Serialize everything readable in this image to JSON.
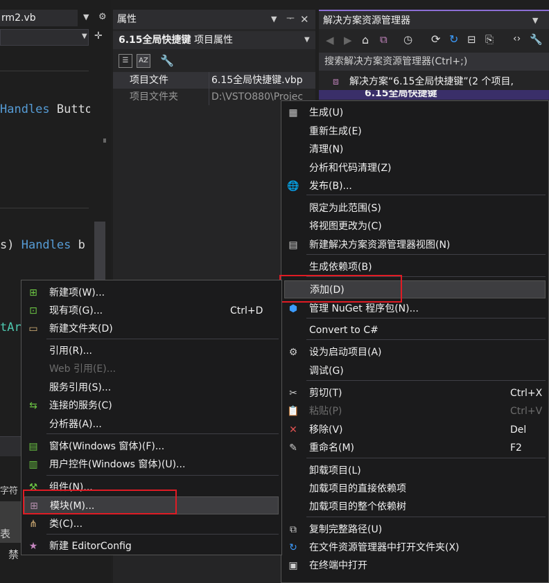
{
  "editor": {
    "tab_title": "rm2.vb",
    "code_line1_kw": "Handles",
    "code_line1_rest": " Butto",
    "code_line2_pre": "s) ",
    "code_line2_kw": "Handles",
    "code_line2_rest": " b",
    "code_line3": "tArg",
    "bottom_text1": "字符",
    "bottom_text2": "表",
    "bottom_text3": "禁"
  },
  "properties": {
    "title": "属性",
    "selected_object": "6.15全局快捷键",
    "selected_object_type": "项目属性",
    "rows": [
      {
        "name": "项目文件",
        "value": "6.15全局快捷键.vbp"
      },
      {
        "name": "项目文件夹",
        "value": "D:\\VSTO880\\Projec"
      }
    ]
  },
  "solution_explorer": {
    "title": "解决方案资源管理器",
    "search_placeholder": "搜索解决方案资源管理器(Ctrl+;)",
    "solution_node": "解决方案“6.15全局快捷键”(2 个项目,",
    "project_node": "6.15全局快捷键"
  },
  "context_menu": {
    "items": [
      {
        "label": "生成(U)",
        "shortcut": "",
        "icon": "build-icon",
        "disabled": false
      },
      {
        "label": "重新生成(E)",
        "shortcut": "",
        "icon": "",
        "disabled": false
      },
      {
        "label": "清理(N)",
        "shortcut": "",
        "icon": "",
        "disabled": false
      },
      {
        "label": "分析和代码清理(Z)",
        "shortcut": "",
        "icon": "",
        "disabled": false
      },
      {
        "label": "发布(B)...",
        "shortcut": "",
        "icon": "globe-icon",
        "disabled": false
      },
      {
        "label": "限定为此范围(S)",
        "shortcut": "",
        "icon": "",
        "disabled": false
      },
      {
        "label": "将视图更改为(C)",
        "shortcut": "",
        "icon": "",
        "disabled": false
      },
      {
        "label": "新建解决方案资源管理器视图(N)",
        "shortcut": "",
        "icon": "new-view-icon",
        "disabled": false
      },
      {
        "label": "生成依赖项(B)",
        "shortcut": "",
        "icon": "",
        "disabled": false
      },
      {
        "label": "添加(D)",
        "shortcut": "",
        "icon": "",
        "disabled": false
      },
      {
        "label": "管理 NuGet 程序包(N)...",
        "shortcut": "",
        "icon": "nuget-icon",
        "disabled": false
      },
      {
        "label": "Convert to C#",
        "shortcut": "",
        "icon": "",
        "disabled": false
      },
      {
        "label": "设为启动项目(A)",
        "shortcut": "",
        "icon": "gear-icon",
        "disabled": false
      },
      {
        "label": "调试(G)",
        "shortcut": "",
        "icon": "",
        "disabled": false
      },
      {
        "label": "剪切(T)",
        "shortcut": "Ctrl+X",
        "icon": "scissors-icon",
        "disabled": false
      },
      {
        "label": "粘贴(P)",
        "shortcut": "Ctrl+V",
        "icon": "paste-icon",
        "disabled": true
      },
      {
        "label": "移除(V)",
        "shortcut": "Del",
        "icon": "remove-icon",
        "disabled": false
      },
      {
        "label": "重命名(M)",
        "shortcut": "F2",
        "icon": "rename-icon",
        "disabled": false
      },
      {
        "label": "卸载项目(L)",
        "shortcut": "",
        "icon": "",
        "disabled": false
      },
      {
        "label": "加载项目的直接依赖项",
        "shortcut": "",
        "icon": "",
        "disabled": false
      },
      {
        "label": "加载项目的整个依赖树",
        "shortcut": "",
        "icon": "",
        "disabled": false
      },
      {
        "label": "复制完整路径(U)",
        "shortcut": "",
        "icon": "copy-icon",
        "disabled": false
      },
      {
        "label": "在文件资源管理器中打开文件夹(X)",
        "shortcut": "",
        "icon": "folder-open-icon",
        "disabled": false
      },
      {
        "label": "在终端中打开",
        "shortcut": "",
        "icon": "terminal-icon",
        "disabled": false
      }
    ]
  },
  "add_submenu": {
    "items": [
      {
        "label": "新建项(W)...",
        "shortcut": "",
        "icon": "new-item-icon",
        "disabled": false
      },
      {
        "label": "现有项(G)...",
        "shortcut": "Ctrl+D",
        "icon": "existing-item-icon",
        "disabled": false
      },
      {
        "label": "新建文件夹(D)",
        "shortcut": "",
        "icon": "new-folder-icon",
        "disabled": false
      },
      {
        "label": "引用(R)...",
        "shortcut": "",
        "icon": "",
        "disabled": false
      },
      {
        "label": "Web 引用(E)...",
        "shortcut": "",
        "icon": "",
        "disabled": true
      },
      {
        "label": "服务引用(S)...",
        "shortcut": "",
        "icon": "",
        "disabled": false
      },
      {
        "label": "连接的服务(C)",
        "shortcut": "",
        "icon": "connected-service-icon",
        "disabled": false
      },
      {
        "label": "分析器(A)...",
        "shortcut": "",
        "icon": "",
        "disabled": false
      },
      {
        "label": "窗体(Windows 窗体)(F)...",
        "shortcut": "",
        "icon": "form-icon",
        "disabled": false
      },
      {
        "label": "用户控件(Windows 窗体)(U)...",
        "shortcut": "",
        "icon": "user-control-icon",
        "disabled": false
      },
      {
        "label": "组件(N)...",
        "shortcut": "",
        "icon": "component-icon",
        "disabled": false
      },
      {
        "label": "模块(M)...",
        "shortcut": "",
        "icon": "module-icon",
        "disabled": false
      },
      {
        "label": "类(C)...",
        "shortcut": "",
        "icon": "class-icon",
        "disabled": false
      },
      {
        "label": "新建 EditorConfig",
        "shortcut": "",
        "icon": "editorconfig-icon",
        "disabled": false
      }
    ]
  },
  "colors": {
    "highlight_border": "#e01b24",
    "keyword": "#569cd6",
    "accent": "#8c6fd6"
  }
}
